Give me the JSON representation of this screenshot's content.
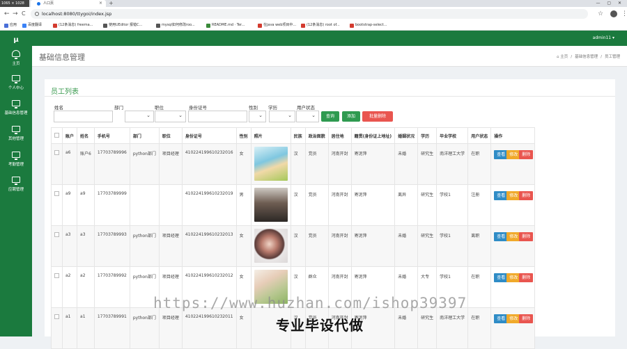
{
  "browser": {
    "window_size": "1065 × 1028",
    "tab_title": "人口页",
    "tab_close": "×",
    "new_tab": "+",
    "window_controls": "— ▢ ✕",
    "back": "←",
    "forward": "→",
    "reload": "C",
    "url": "localhost:8080/ttygoi/index.jsp",
    "star": "☆",
    "menu": "⋮",
    "bookmarks": [
      {
        "label": "应用",
        "color": "#4a6fd8"
      },
      {
        "label": "百度翻译",
        "color": "#3b82f6"
      },
      {
        "label": "(12条消息) freema...",
        "color": "#d33b2f"
      },
      {
        "label": "使用UEditor 报错C...",
        "color": "#555555"
      },
      {
        "label": "mysql如何修改roo...",
        "color": "#555555"
      },
      {
        "label": "README.md · Ter...",
        "color": "#3a8a3a"
      },
      {
        "label": "在java web项目中...",
        "color": "#d33b2f"
      },
      {
        "label": "(12条消息) root of...",
        "color": "#d33b2f"
      },
      {
        "label": "bootstrap-select...",
        "color": "#d33b2f"
      }
    ]
  },
  "sidebar": {
    "logo": "μ",
    "items": [
      {
        "label": "主页",
        "icon": "dashboard-icon"
      },
      {
        "label": "个人中心",
        "icon": "monitor-icon"
      },
      {
        "label": "基础信息管理",
        "icon": "monitor-icon"
      },
      {
        "label": "其他管理",
        "icon": "monitor-icon"
      },
      {
        "label": "考勤管理",
        "icon": "monitor-icon"
      },
      {
        "label": "应聘管理",
        "icon": "monitor-icon"
      }
    ]
  },
  "topbar": {
    "user": "admin11 ▾"
  },
  "page": {
    "title": "基础信息管理",
    "breadcrumb": [
      "⌂ 主页",
      "基础信息管理",
      "员工管理"
    ],
    "breadcrumb_sep": "/"
  },
  "panel": {
    "title": "员工列表",
    "filters": {
      "name": "姓名",
      "dept": "部门",
      "position": "职位",
      "idcard": "身份证号",
      "gender": "性别",
      "education": "学历",
      "status": "用户状态"
    },
    "buttons": {
      "search": "查询",
      "add": "添加",
      "batch_delete": "批量删除"
    }
  },
  "table": {
    "headers": [
      "账户",
      "姓名",
      "手机号",
      "部门",
      "职位",
      "身份证号",
      "性别",
      "照片",
      "民族",
      "政治面貌",
      "居住地",
      "籍贯(身份证上地址)",
      "婚姻状况",
      "学历",
      "毕业学校",
      "用户状态",
      "操作"
    ],
    "actions": {
      "view": "查看",
      "edit": "修改",
      "delete": "删除"
    },
    "rows": [
      {
        "account": "a6",
        "name": "账户6",
        "phone": "17703789996",
        "dept": "python部门",
        "position": "项目经理",
        "idcard": "410224199610232016",
        "gender": "女",
        "photo": "ph1",
        "ethnic": "汉",
        "political": "党员",
        "residence": "河南开封",
        "native": "寄泥萍",
        "marital": "未婚",
        "education": "研究生",
        "school": "南洋理工大学",
        "status": "在职"
      },
      {
        "account": "a9",
        "name": "a9",
        "phone": "17703789999",
        "dept": "",
        "position": "",
        "idcard": "410224199610232019",
        "gender": "男",
        "photo": "ph2",
        "ethnic": "汉",
        "political": "党员",
        "residence": "河南开封",
        "native": "寄泥萍",
        "marital": "离异",
        "education": "研究生",
        "school": "学校1",
        "status": "注册"
      },
      {
        "account": "a3",
        "name": "a3",
        "phone": "17703789993",
        "dept": "python部门",
        "position": "项目经理",
        "idcard": "410224199610232013",
        "gender": "女",
        "photo": "ph3",
        "ethnic": "汉",
        "political": "党员",
        "residence": "河南开封",
        "native": "寄泥萍",
        "marital": "未婚",
        "education": "研究生",
        "school": "学校1",
        "status": "离职"
      },
      {
        "account": "a2",
        "name": "a2",
        "phone": "17703789992",
        "dept": "python部门",
        "position": "项目经理",
        "idcard": "410224199610232012",
        "gender": "女",
        "photo": "ph4",
        "ethnic": "汉",
        "political": "群众",
        "residence": "河南开封",
        "native": "寄泥萍",
        "marital": "未婚",
        "education": "大专",
        "school": "学校1",
        "status": "在职"
      },
      {
        "account": "a1",
        "name": "a1",
        "phone": "17703789991",
        "dept": "python部门",
        "position": "项目经理",
        "idcard": "410224199610232011",
        "gender": "女",
        "photo": "",
        "ethnic": "汉",
        "political": "党员",
        "residence": "河南开封",
        "native": "寄泥萍",
        "marital": "未婚",
        "education": "研究生",
        "school": "南洋理工大学",
        "status": "在职"
      }
    ]
  },
  "watermark": {
    "url": "https://www.huzhan.com/ishop39397",
    "caption": "专业毕设代做"
  },
  "colors": {
    "sidebar": "#1b7a3e",
    "accent": "#3a9a4f",
    "search_btn": "#2f9a50",
    "add_btn": "#2f9a50",
    "delete_btn": "#e9554f",
    "view_btn": "#2f8cc6",
    "edit_btn": "#f0a92a"
  }
}
